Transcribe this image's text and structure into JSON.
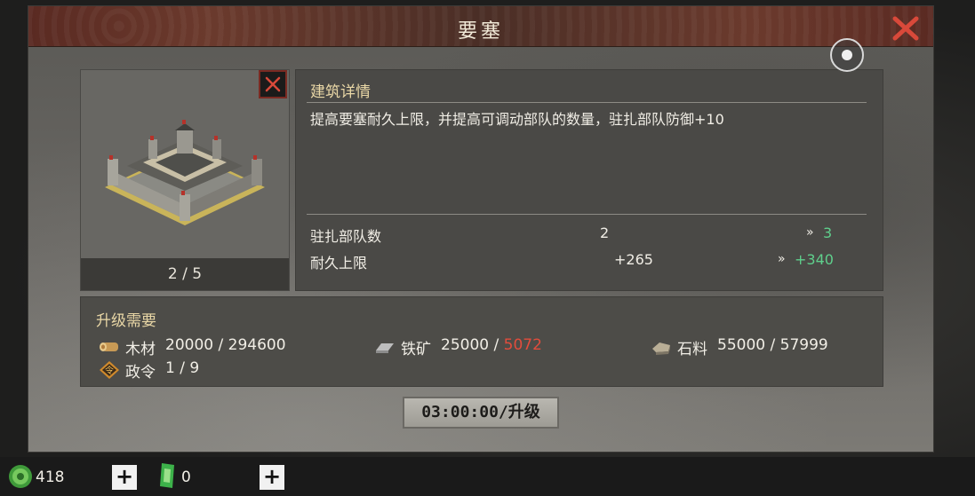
{
  "dialog": {
    "title": "要塞",
    "close_icon": "close-x-icon",
    "record_icon": "record-icon"
  },
  "building": {
    "level": "2 / 5",
    "tag_icon": "close-x-icon"
  },
  "details": {
    "heading": "建筑详情",
    "description": "提高要塞耐久上限，并提高可调动部队的数量，驻扎部队防御+10",
    "stats": [
      {
        "label": "驻扎部队数",
        "current": "2",
        "arrow": "»",
        "next": "3"
      },
      {
        "label": "耐久上限",
        "current": "+265",
        "arrow": "»",
        "next": "+340"
      }
    ]
  },
  "upgrade": {
    "heading": "升级需要",
    "resources": [
      {
        "icon": "wood-icon",
        "name": "木材",
        "required": "20000",
        "separator": " / ",
        "owned": "294600",
        "sufficient": true
      },
      {
        "icon": "iron-icon",
        "name": "铁矿",
        "required": "25000",
        "separator": " / ",
        "owned": "5072",
        "sufficient": false
      },
      {
        "icon": "stone-icon",
        "name": "石料",
        "required": "55000",
        "separator": " / ",
        "owned": "57999",
        "sufficient": true
      },
      {
        "icon": "decree-icon",
        "name": "政令",
        "required": "1",
        "separator": " / ",
        "owned": "9",
        "sufficient": true
      }
    ],
    "button_label": "03:00:00/升级"
  },
  "bottom_bar": {
    "jade": {
      "icon": "jade-coin-icon",
      "amount": "418"
    },
    "token": {
      "icon": "green-token-icon",
      "amount": "0"
    },
    "plus_label": "+"
  },
  "colors": {
    "positive": "#5fcf8c",
    "insufficient": "#e24c3c",
    "heading_gold": "#e9d7a6",
    "close_red": "#d9493a"
  }
}
